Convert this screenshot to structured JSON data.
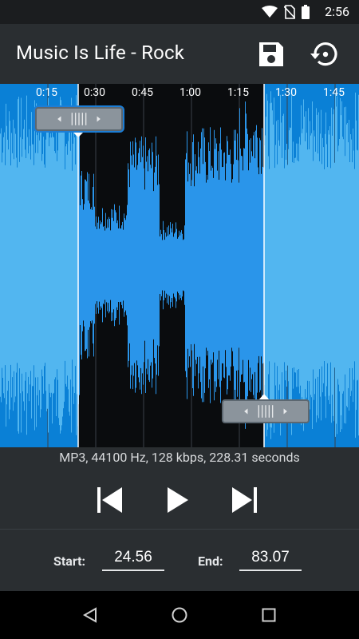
{
  "status_bar": {
    "time": "2:56"
  },
  "app_bar": {
    "title": "Music Is Life - Rock"
  },
  "timeline": {
    "ticks": [
      "0:15",
      "0:30",
      "0:45",
      "1:00",
      "1:15",
      "1:30",
      "1:45"
    ]
  },
  "info": {
    "text": "MP3, 44100 Hz, 128 kbps, 228.31 seconds"
  },
  "fields": {
    "start_label": "Start:",
    "start_value": "24.56",
    "end_label": "End:",
    "end_value": "83.07"
  },
  "colors": {
    "wave_light": "#52b6f0",
    "wave_selected": "#2a95ea",
    "wave_bg_outside": "#0a80d6",
    "bg": "#2a2e31"
  },
  "icons": [
    "wifi-icon",
    "no-sim-icon",
    "battery-icon",
    "save-icon",
    "revert-icon",
    "skip-previous-icon",
    "play-icon",
    "skip-next-icon",
    "nav-back-icon",
    "nav-home-icon",
    "nav-recents-icon"
  ]
}
